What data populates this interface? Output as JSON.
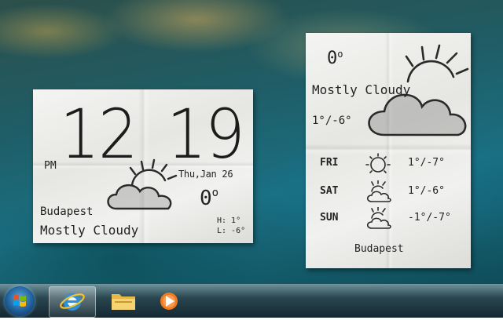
{
  "clock_widget": {
    "hour": "12",
    "minute": "19",
    "ampm": "PM",
    "date": "Thu,Jan 26",
    "temp": "0",
    "city": "Budapest",
    "condition": "Mostly Cloudy",
    "high": "H: 1°",
    "low": "L: -6°",
    "icon": "mostly-cloudy-icon"
  },
  "forecast_widget": {
    "temp": "0",
    "condition": "Mostly Cloudy",
    "range": "1°/-6°",
    "icon": "mostly-cloudy-icon",
    "days": [
      {
        "day": "FRI",
        "range": "1°/-7°",
        "icon": "sunny-icon"
      },
      {
        "day": "SAT",
        "range": "1°/-6°",
        "icon": "partly-cloudy-icon"
      },
      {
        "day": "SUN",
        "range": "-1°/-7°",
        "icon": "partly-cloudy-icon"
      }
    ],
    "city": "Budapest"
  },
  "taskbar": {
    "items": [
      {
        "name": "Start",
        "icon": "windows-logo-icon"
      },
      {
        "name": "Internet Explorer",
        "icon": "internet-explorer-icon"
      },
      {
        "name": "Windows Explorer",
        "icon": "folder-icon"
      },
      {
        "name": "Windows Media Player",
        "icon": "media-player-icon"
      }
    ]
  },
  "colors": {
    "paper": "#eeeeec",
    "ink": "#222222",
    "taskbar": "#1c3a44"
  }
}
